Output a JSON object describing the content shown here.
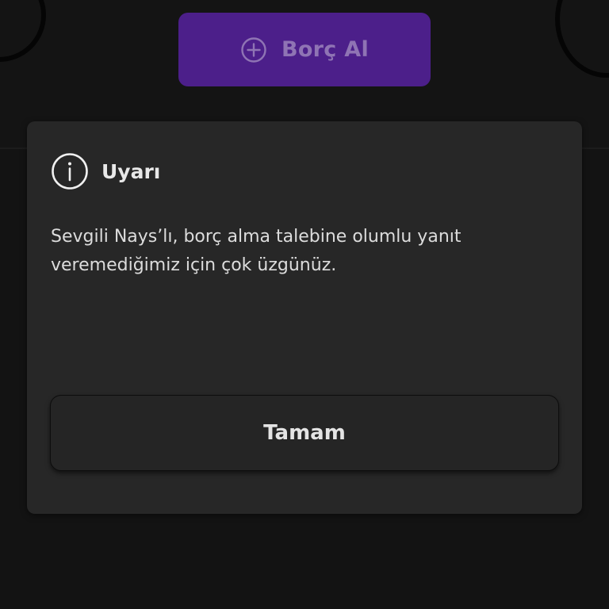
{
  "background": {
    "borrow_button": {
      "label": "Borç Al",
      "icon": "plus-circle-icon",
      "color": "#4c1f8a"
    }
  },
  "dialog": {
    "icon": "info-circle-icon",
    "title": "Uyarı",
    "message": "Sevgili Nays’lı, borç alma talebine olumlu yanıt veremediğimiz için çok üzgünüz.",
    "ok_button_label": "Tamam"
  }
}
